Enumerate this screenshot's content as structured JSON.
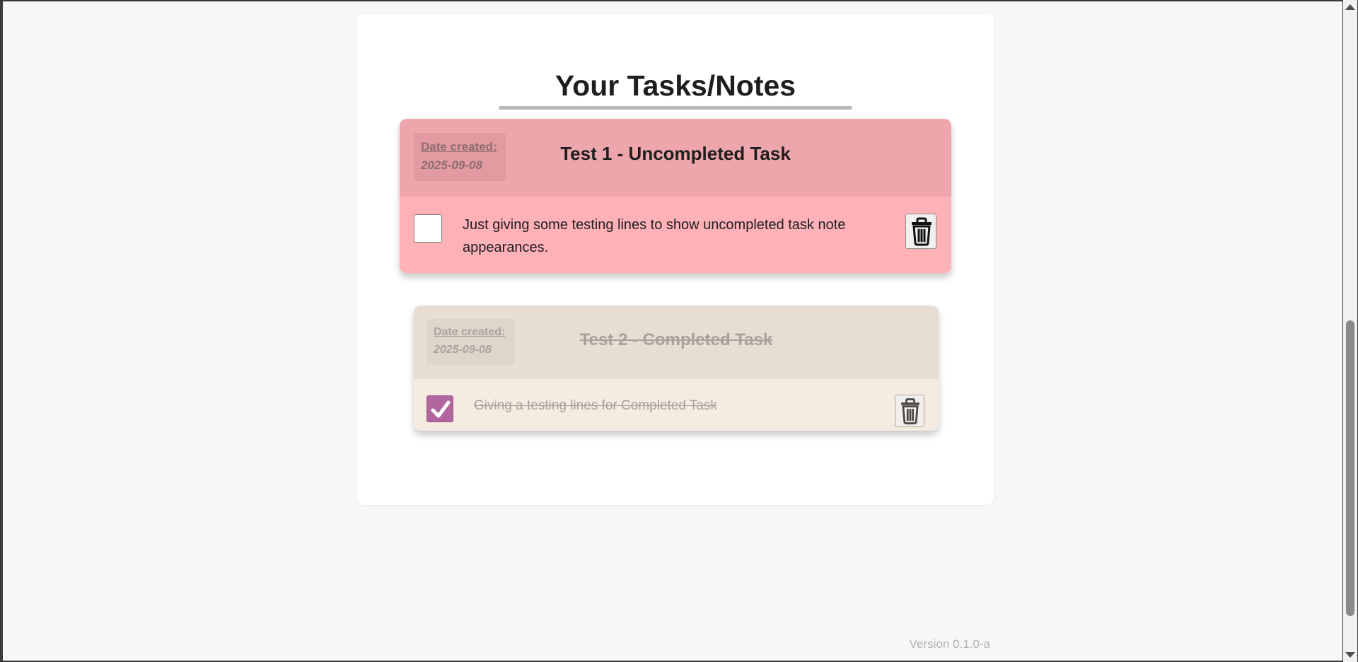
{
  "page": {
    "title": "Your Tasks/Notes",
    "version": "Version 0.1.0-a"
  },
  "tasks": [
    {
      "date_label": "Date created:",
      "date_value": "2025-09-08",
      "title": "Test 1 - Uncompleted Task",
      "text": "Just giving some testing lines to show uncompleted task note appearances.",
      "completed": false
    },
    {
      "date_label": "Date created:",
      "date_value": "2025-09-08",
      "title": "Test 2 - Completed Task",
      "text": "Giving a testing lines for Completed Task",
      "completed": true
    }
  ],
  "icons": {
    "delete": "trash-icon",
    "checked": "checkmark-icon"
  },
  "colors": {
    "uncompleted_header": "#eda6ab",
    "uncompleted_body": "#ffb1b8",
    "completed_header": "#e7ddd2",
    "completed_body": "#f5ebe1",
    "checkbox_checked": "#b2669f"
  }
}
